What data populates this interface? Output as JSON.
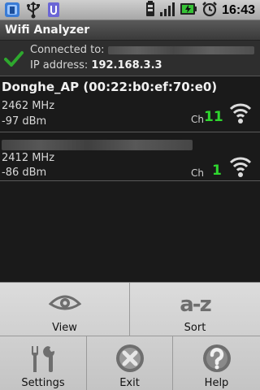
{
  "status_bar": {
    "icons_left": [
      "app-notification-icon",
      "usb-icon",
      "usb-storage-icon"
    ],
    "icons_right": [
      "battery-small-icon",
      "signal-icon",
      "charging-battery-icon",
      "alarm-icon"
    ],
    "time": "16:43"
  },
  "app": {
    "title": "Wifi Analyzer"
  },
  "connection": {
    "connected_label": "Connected to:",
    "ip_label": "IP address:",
    "ip_value": "192.168.3.3",
    "status_color": "#2ea82e"
  },
  "access_points": [
    {
      "ssid": "Donghe_AP (00:22:b0:ef:70:e0)",
      "frequency": "2462 MHz",
      "signal": "-97 dBm",
      "channel_label": "Ch",
      "channel": "11"
    },
    {
      "ssid": "",
      "frequency": "2412 MHz",
      "signal": "-86 dBm",
      "channel_label": "Ch",
      "channel": "1"
    }
  ],
  "menu": {
    "view": "View",
    "sort": "Sort",
    "sort_glyph": "a-z",
    "settings": "Settings",
    "exit": "Exit",
    "help": "Help"
  },
  "colors": {
    "channel": "#2fd62f",
    "menu_bg": "#d2d2d2",
    "background": "#1a1a1a"
  }
}
